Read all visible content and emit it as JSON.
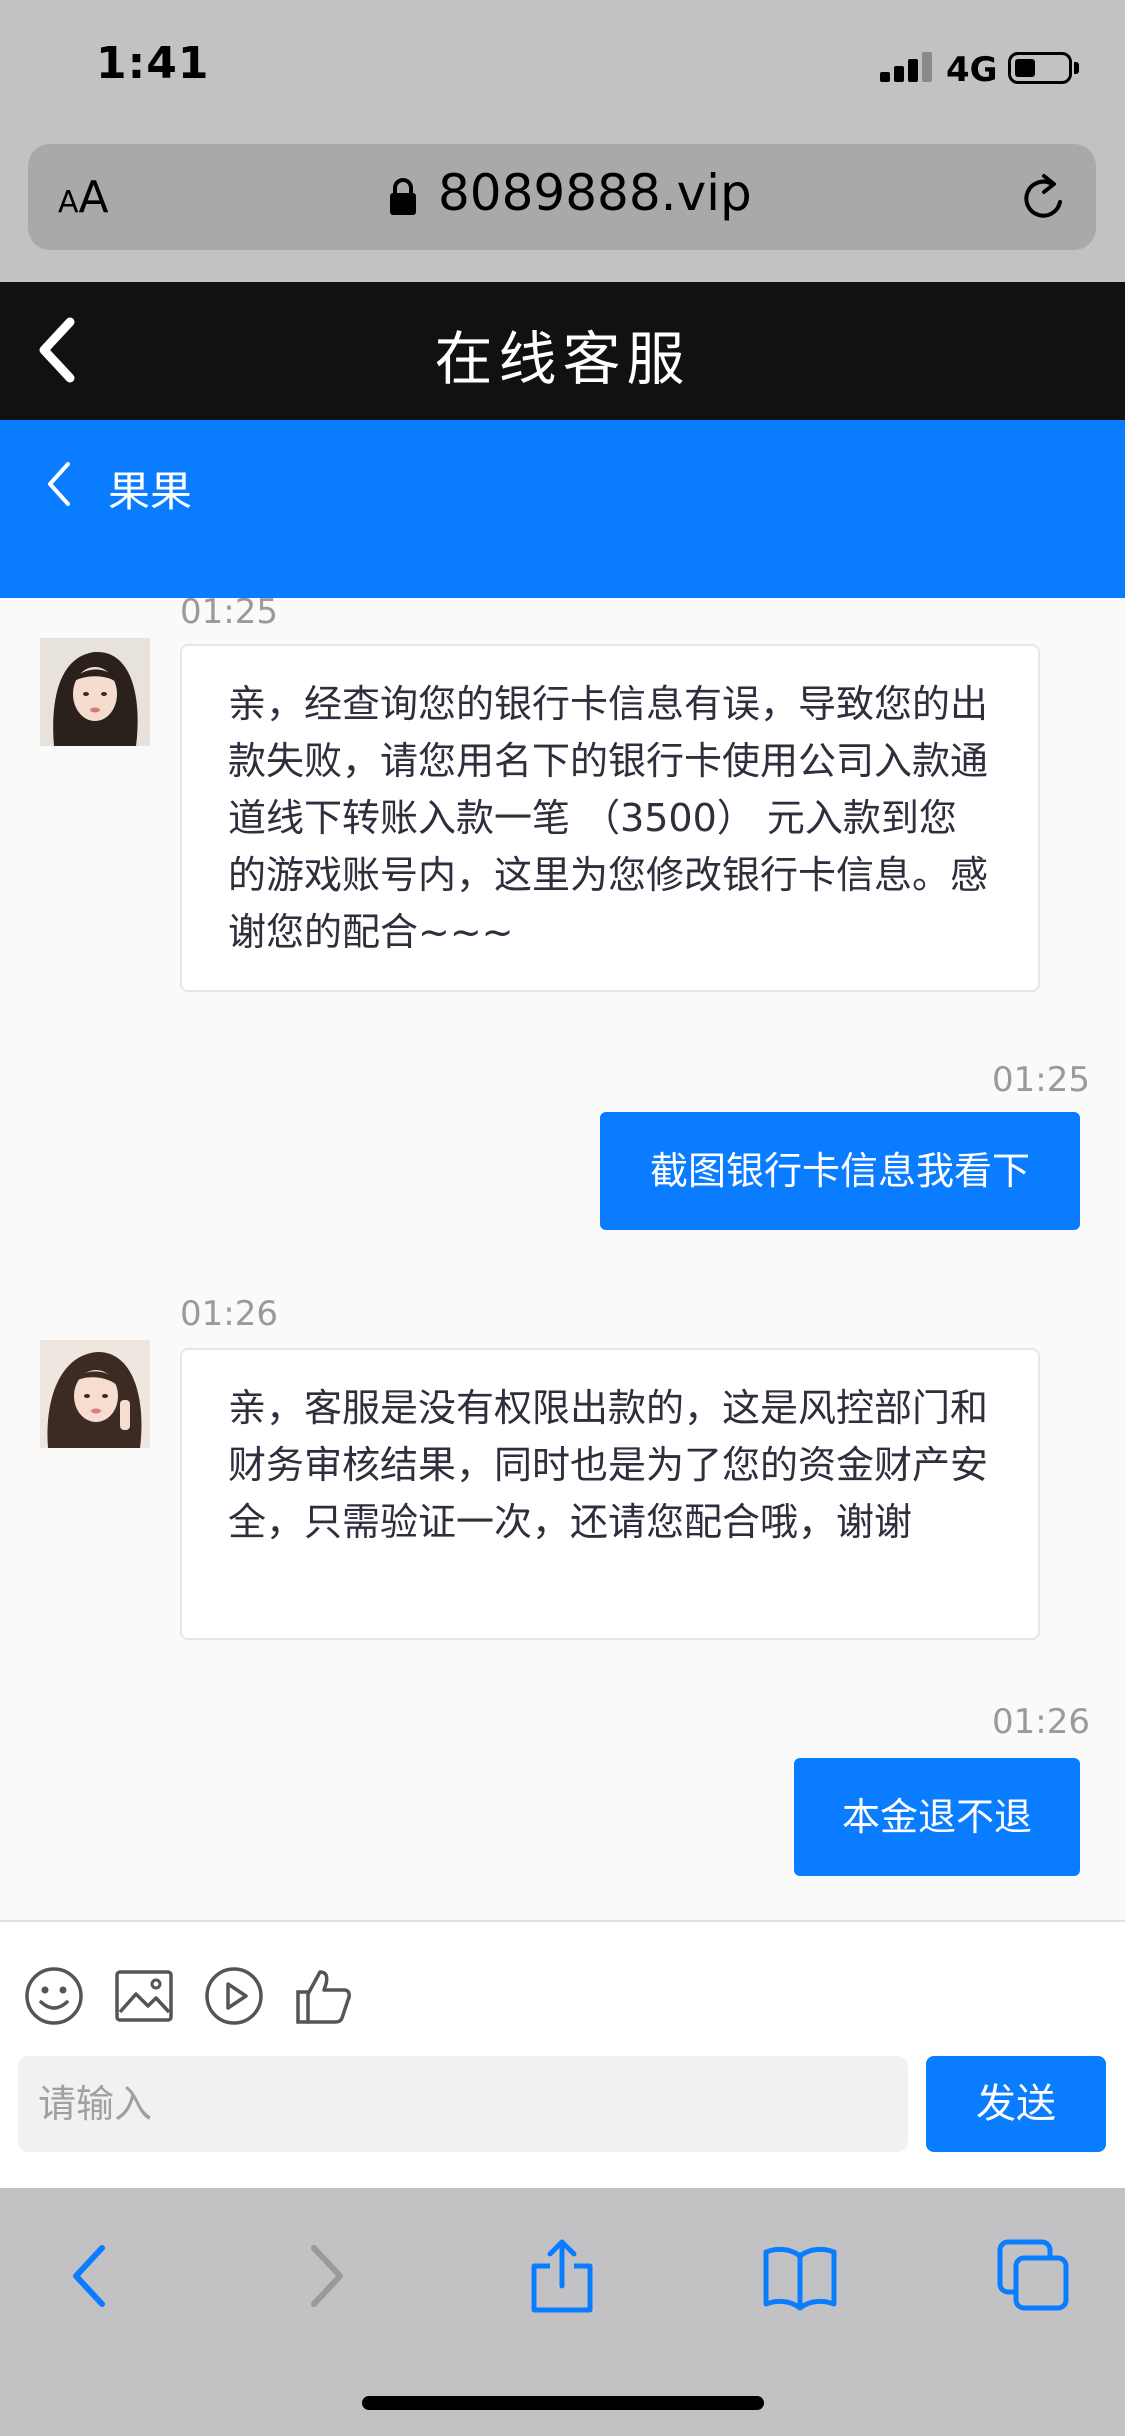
{
  "status_bar": {
    "time": "1:41",
    "network": "4G",
    "battery_level": 0.35
  },
  "address_bar": {
    "text_size_small": "A",
    "text_size_large": "A",
    "url": "8089888.vip"
  },
  "site_header": {
    "title": "在线客服"
  },
  "chat_header": {
    "agent_name": "果果"
  },
  "messages": [
    {
      "side": "in",
      "time": "01:25",
      "text": "亲，经查询您的银行卡信息有误，导致您的出款失败，请您用名下的银行卡使用公司入款通道线下转账入款一笔 （3500） 元入款到您的游戏账号内，这里为您修改银行卡信息。感谢您的配合~~~"
    },
    {
      "side": "out",
      "time": "01:25",
      "text": "截图银行卡信息我看下"
    },
    {
      "side": "in",
      "time": "01:26",
      "text": "亲，客服是没有权限出款的，这是风控部门和财务审核结果，同时也是为了您的资金财产安全，只需验证一次，还请您配合哦，谢谢"
    },
    {
      "side": "out",
      "time": "01:26",
      "text": "本金退不退"
    }
  ],
  "composer": {
    "tools": [
      "emoji-icon",
      "image-icon",
      "video-icon",
      "thumbs-up-icon"
    ],
    "placeholder": "请输入",
    "send_label": "发送"
  },
  "toolbar": {
    "icons": [
      "back-icon",
      "forward-icon",
      "share-icon",
      "bookmarks-icon",
      "tabs-icon"
    ]
  },
  "colors": {
    "accent": "#0a7cff",
    "header": "#111111",
    "chrome": "#c2c2c4"
  }
}
